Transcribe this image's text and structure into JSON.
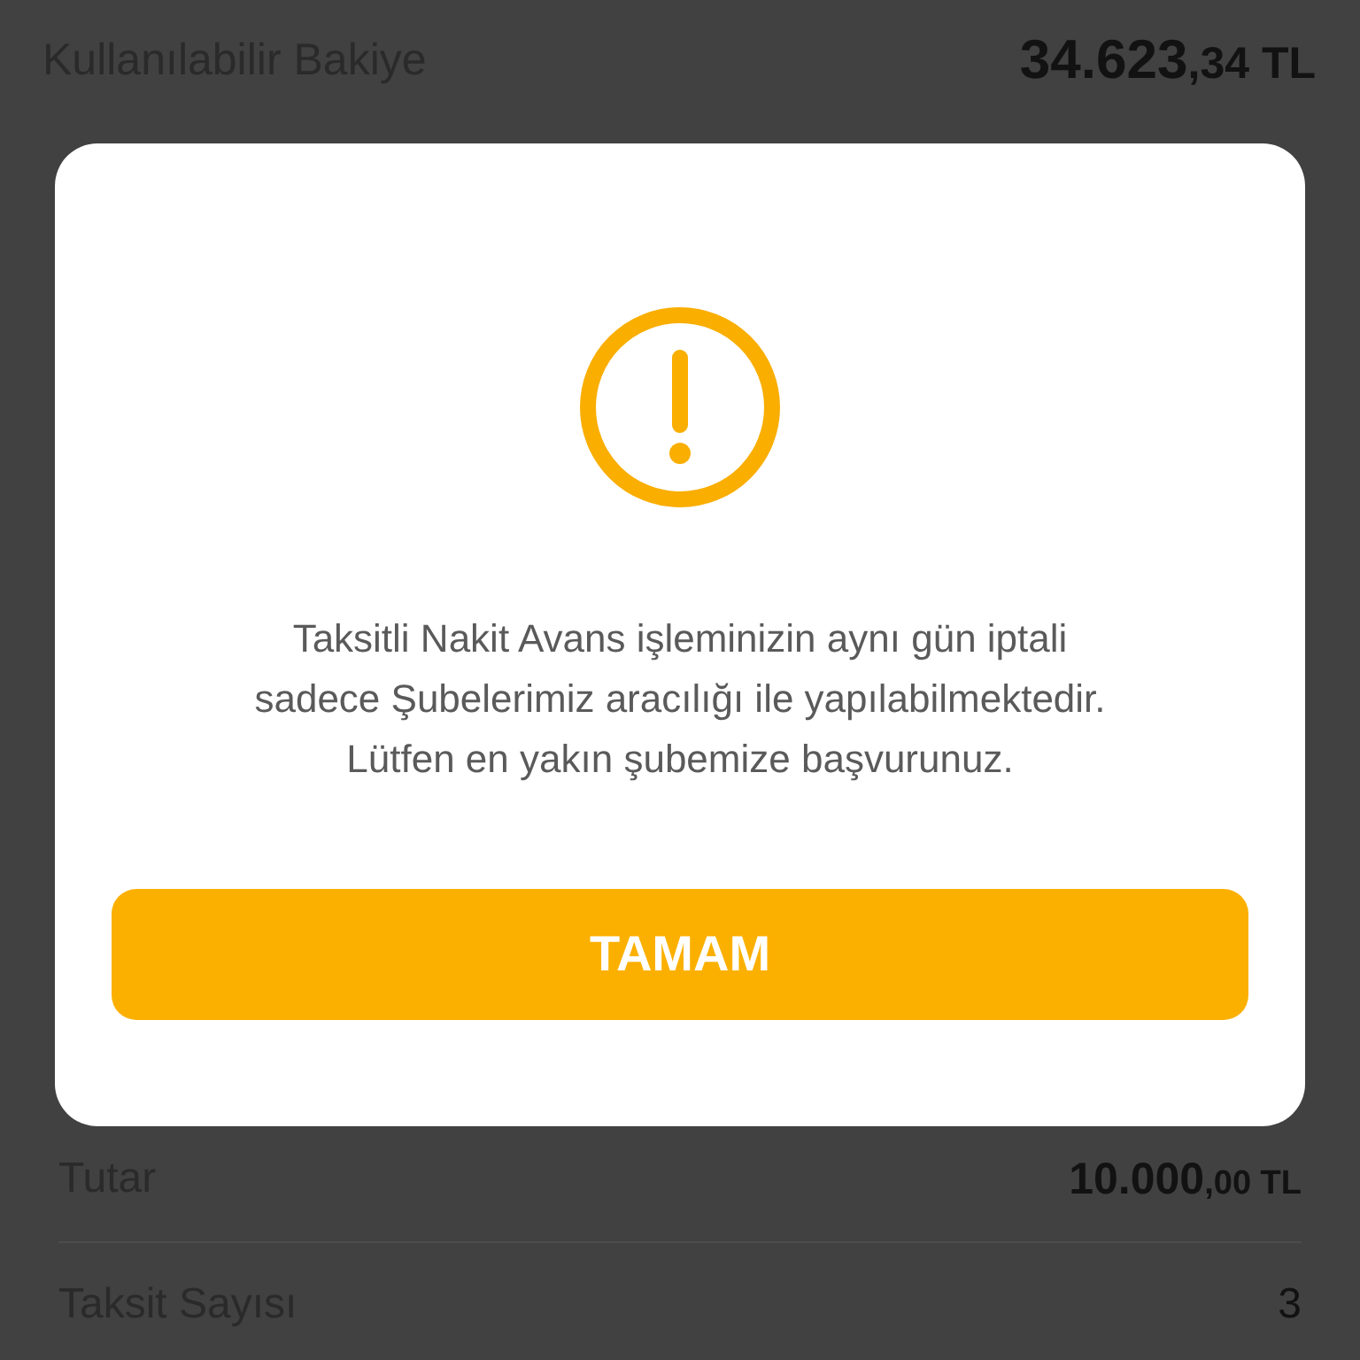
{
  "balance": {
    "label": "Kullanılabilir Bakiye",
    "amount_integer": "34.623",
    "amount_fraction": ",34 TL"
  },
  "dialog": {
    "message": "Taksitli Nakit Avans işleminizin aynı gün iptali\nsadece Şubelerimiz aracılığı ile yapılabilmektedir.\nLütfen en yakın şubemize başvurunuz.",
    "button": "TAMAM"
  },
  "details": [
    {
      "kind": "amount",
      "label": "Tutar",
      "amount_integer": "10.000",
      "amount_fraction": ",00 TL"
    },
    {
      "kind": "plain",
      "label": "Taksit Sayısı",
      "value": "3"
    }
  ]
}
